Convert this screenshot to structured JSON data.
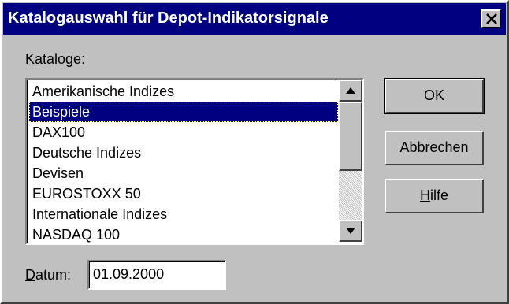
{
  "window": {
    "title": "Katalogauswahl für Depot-Indikatorsignale",
    "close_icon": "close-icon"
  },
  "catalogs": {
    "label_mnemonic": "K",
    "label_rest": "ataloge:",
    "items": [
      "Amerikanische Indizes",
      "Beispiele",
      "DAX100",
      "Deutsche Indizes",
      "Devisen",
      "EUROSTOXX 50",
      "Internationale Indizes",
      "NASDAQ 100"
    ],
    "selected": "Beispiele",
    "scroll_up_icon": "arrow-up-icon",
    "scroll_down_icon": "arrow-down-icon"
  },
  "buttons": {
    "ok": "OK",
    "cancel": "Abbrechen",
    "help_mnemonic": "H",
    "help_rest": "ilfe"
  },
  "date": {
    "label_mnemonic": "D",
    "label_rest": "atum:",
    "value": "01.09.2000"
  },
  "colors": {
    "title_bar": "#000080",
    "selection": "#000080",
    "face": "#c0c0c0"
  }
}
